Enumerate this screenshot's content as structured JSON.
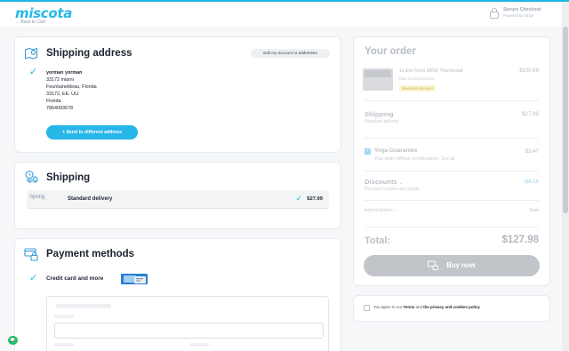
{
  "header": {
    "logo": "miscota",
    "back_link": "← Back to Cart",
    "secure_title": "Secure Checkout",
    "secure_sub": "Powered by stripe"
  },
  "shipping_address": {
    "title": "Shipping address",
    "edit_button": "Edit my account or addresses",
    "name": "yorman yorman",
    "street": "33172 miami",
    "city_line": "Fountainebleau, Florida",
    "zip_line": "33172, EE. UU.",
    "state": "Florida",
    "phone": "7864093678",
    "send_button": "+   Send to different address"
  },
  "shipping": {
    "title": "Shipping",
    "carrier": "Spring",
    "method": "Standard delivery",
    "price": "$27.99"
  },
  "payment": {
    "title": "Payment methods",
    "option": "Credit card and more"
  },
  "order": {
    "title": "Your order",
    "product_name": "1x  Exo Terra 100W Thermostat",
    "product_sub": "Exo/ 25.5x17x4.5 cm",
    "product_badge": "Maximum discount",
    "product_price": "$100.68",
    "shipping_label": "Shipping",
    "shipping_sub": "Standard delivery",
    "shipping_price": "$27.99",
    "yoga_label": "Yoga Guarantee",
    "yoga_sub": "Your order without complications. See all",
    "yoga_price": "$3.47",
    "discounts_label": "Discounts",
    "discounts_chevron": "⌄",
    "discounts_sub": "Discount coupon and points",
    "discounts_price": "-$4.16",
    "admin_label": "Administration  ⌄",
    "admin_value": "Free",
    "total_label": "Total:",
    "total_value": "$127.98",
    "buy_button": "Buy now"
  },
  "terms": {
    "prefix": "You agree to our ",
    "terms_link": "Terms",
    "middle": " and ",
    "policy_link": "the privacy and cookies policy"
  },
  "chat": {
    "label": "💬"
  },
  "colors": {
    "accent": "#27b6e8",
    "disabled_button": "#c1c4c9",
    "chat": "#23c26a"
  }
}
